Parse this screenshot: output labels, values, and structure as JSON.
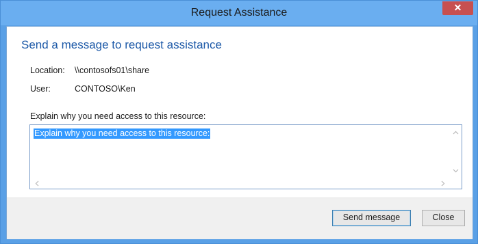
{
  "window": {
    "title": "Request Assistance",
    "close_glyph": "✕"
  },
  "heading": "Send a message to request assistance",
  "info": {
    "location_label": "Location:",
    "location_value": "\\\\contosofs01\\share",
    "user_label": "User:",
    "user_value": "CONTOSO\\Ken"
  },
  "message": {
    "prompt": "Explain why you need access to this resource:",
    "value": "Explain why you need access to this resource:"
  },
  "buttons": {
    "send": "Send message",
    "close": "Close"
  },
  "icons": {
    "scroll_up": "up-arrow-icon",
    "scroll_down": "down-arrow-icon",
    "scroll_left": "left-arrow-icon",
    "scroll_right": "right-arrow-icon"
  },
  "colors": {
    "title_bar": "#6aaef0",
    "heading": "#1e5aa8",
    "selection": "#3399ff",
    "close_button": "#c75050"
  }
}
